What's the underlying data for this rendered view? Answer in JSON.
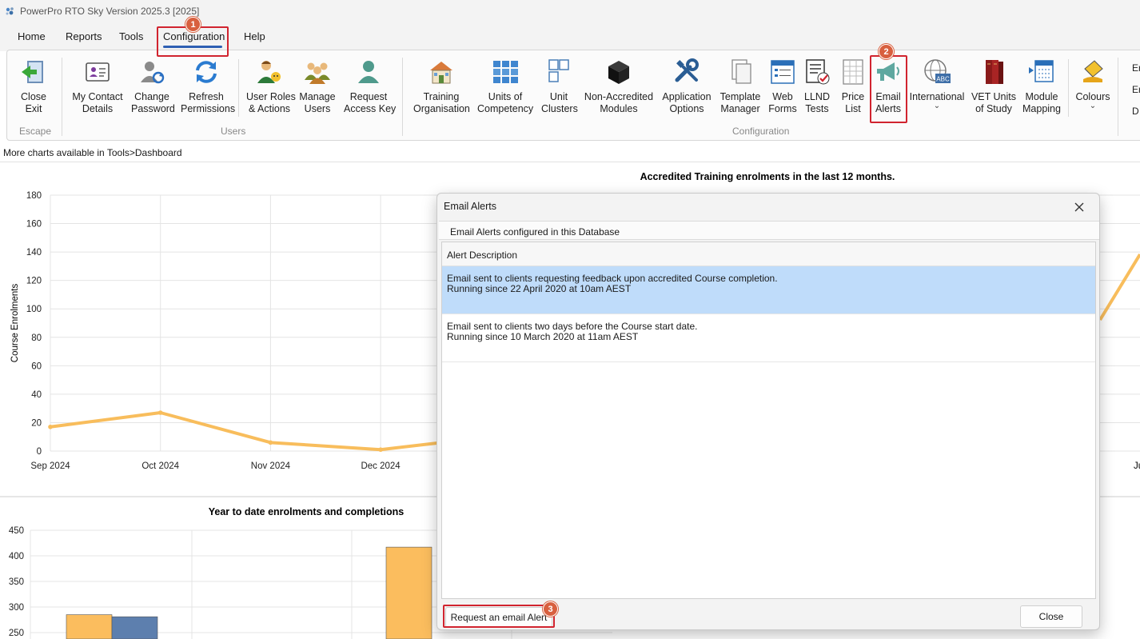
{
  "window": {
    "title": "PowerPro RTO Sky Version 2025.3 [2025]"
  },
  "menu": {
    "items": [
      "Home",
      "Reports",
      "Tools",
      "Configuration",
      "Help"
    ],
    "active": "Configuration"
  },
  "ribbon": {
    "groups": [
      {
        "label": "Escape",
        "buttons": [
          {
            "label1": "Close",
            "label2": "Exit",
            "icon": "exit-door-icon"
          }
        ]
      },
      {
        "label": "Users",
        "buttons": [
          {
            "label1": "My Contact",
            "label2": "Details",
            "icon": "contact-card-icon"
          },
          {
            "label1": "Change",
            "label2": "Password",
            "icon": "user-refresh-icon"
          },
          {
            "label1": "Refresh",
            "label2": "Permissions",
            "icon": "refresh-arrows-icon"
          },
          {
            "label1": "User Roles",
            "label2": "& Actions",
            "icon": "user-roles-icon"
          },
          {
            "label1": "Manage",
            "label2": "Users",
            "icon": "group-users-icon"
          },
          {
            "label1": "Request",
            "label2": "Access Key",
            "icon": "user-key-icon"
          }
        ]
      },
      {
        "label": "Configuration",
        "buttons": [
          {
            "label1": "Training",
            "label2": "Organisation",
            "icon": "building-icon"
          },
          {
            "label1": "Units of",
            "label2": "Competency",
            "icon": "grid-blocks-icon"
          },
          {
            "label1": "Unit",
            "label2": "Clusters",
            "icon": "cluster-squares-icon"
          },
          {
            "label1": "Non-Accredited",
            "label2": "Modules",
            "icon": "black-cube-icon"
          },
          {
            "label1": "Application",
            "label2": "Options",
            "icon": "tools-icon"
          },
          {
            "label1": "Template",
            "label2": "Manager",
            "icon": "documents-icon"
          },
          {
            "label1": "Web",
            "label2": "Forms",
            "icon": "web-form-icon"
          },
          {
            "label1": "LLND",
            "label2": "Tests",
            "icon": "checklist-icon"
          },
          {
            "label1": "Price",
            "label2": "List",
            "icon": "price-sheet-icon"
          },
          {
            "label1": "Email",
            "label2": "Alerts",
            "icon": "megaphone-icon"
          },
          {
            "label1": "International",
            "label2": "",
            "icon": "globe-abc-icon",
            "dropdown": true
          },
          {
            "label1": "VET Units",
            "label2": "of Study",
            "icon": "books-icon"
          },
          {
            "label1": "Module",
            "label2": "Mapping",
            "icon": "mapping-icon"
          },
          {
            "label1": "Colours",
            "label2": "",
            "icon": "paint-bucket-icon",
            "dropdown": true
          }
        ]
      }
    ],
    "cutoff_labels": [
      "Er",
      "Er",
      "D"
    ]
  },
  "hint": "More charts available in Tools>Dashboard",
  "charts": {
    "line": {
      "title": "Accredited Training enrolments in the last 12 months.",
      "ylabel": "Course Enrolments",
      "yticks": [
        "180",
        "160",
        "140",
        "120",
        "100",
        "80",
        "60",
        "40",
        "20",
        "0"
      ],
      "xticks": [
        "Sep 2024",
        "Oct 2024",
        "Nov 2024",
        "Dec 2024"
      ],
      "x_right_cut": "Ju"
    },
    "bar": {
      "title": "Year to date enrolments and completions",
      "yticks": [
        "450",
        "400",
        "350",
        "300",
        "250"
      ]
    }
  },
  "chart_data": [
    {
      "type": "line",
      "title": "Accredited Training enrolments in the last 12 months.",
      "xlabel": "",
      "ylabel": "Course Enrolments",
      "ylim": [
        0,
        180
      ],
      "categories": [
        "Sep 2024",
        "Oct 2024",
        "Nov 2024",
        "Dec 2024"
      ],
      "series": [
        {
          "color": "#f8bd5c",
          "values": [
            17,
            27,
            6,
            1
          ]
        }
      ],
      "grid": true
    },
    {
      "type": "bar",
      "title": "Year to date enrolments and completions",
      "ylim": [
        250,
        450
      ],
      "categories": [
        "",
        "",
        ""
      ],
      "series": [
        {
          "color": "#fbbd5e",
          "values": [
            285,
            null,
            417
          ]
        },
        {
          "color": "#5d7fae",
          "values": [
            281,
            null,
            null
          ]
        }
      ],
      "grid": true
    }
  ],
  "dialog": {
    "title": "Email Alerts",
    "section_label": "Email Alerts configured in this Database",
    "column_header": "Alert Description",
    "rows": [
      {
        "line1": "Email sent to clients requesting feedback upon accredited Course completion.",
        "line2": "Running since 22 April 2020 at 10am AEST",
        "selected": true
      },
      {
        "line1": "Email sent to clients two days before the Course start date.",
        "line2": "Running since 10 March 2020 at 11am AEST",
        "selected": false
      }
    ],
    "request_button": "Request an email Alert",
    "close_button": "Close"
  },
  "callouts": [
    "1",
    "2",
    "3"
  ],
  "colors": {
    "accent": "#2e5fb3",
    "callout": "#d1242f",
    "badge": "#d8603f",
    "selection": "#bfdcfa",
    "line_series": "#f8bd5c",
    "bar_orange": "#fbbd5e",
    "bar_blue": "#5d7fae"
  }
}
